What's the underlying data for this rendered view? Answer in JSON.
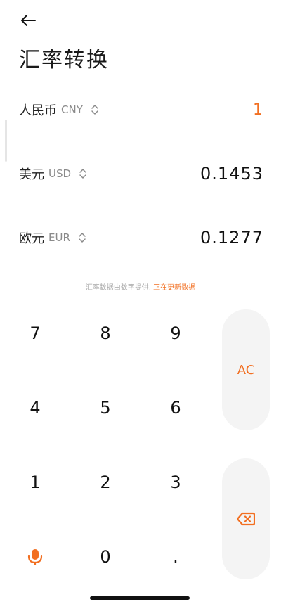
{
  "header": {
    "title": "汇率转换"
  },
  "currencies": [
    {
      "name": "人民币",
      "code": "CNY",
      "value": "1"
    },
    {
      "name": "美元",
      "code": "USD",
      "value": "0.1453"
    },
    {
      "name": "欧元",
      "code": "EUR",
      "value": "0.1277"
    }
  ],
  "notice": {
    "text": "汇率数据由数字提供, ",
    "link": "正在更新数据"
  },
  "keypad": {
    "k7": "7",
    "k8": "8",
    "k9": "9",
    "k4": "4",
    "k5": "5",
    "k6": "6",
    "k1": "1",
    "k2": "2",
    "k3": "3",
    "k0": "0",
    "dot": ".",
    "ac": "AC"
  },
  "colors": {
    "accent": "#f26f21",
    "side_key_bg": "#f4f4f4"
  },
  "icons": {
    "back": "arrow-left-icon",
    "chevron": "chevron-up-down-icon",
    "mic": "microphone-icon",
    "backspace": "backspace-icon"
  }
}
